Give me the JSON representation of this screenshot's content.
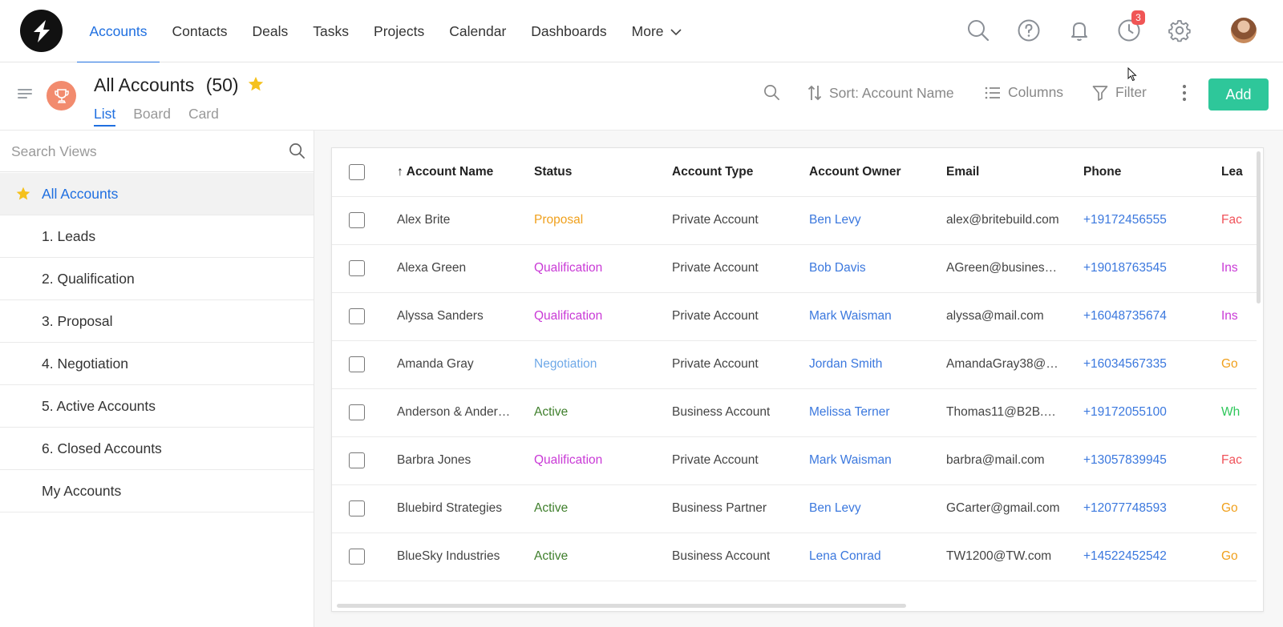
{
  "nav": {
    "links": [
      "Accounts",
      "Contacts",
      "Deals",
      "Tasks",
      "Projects",
      "Calendar",
      "Dashboards",
      "More"
    ],
    "active": "Accounts",
    "reminders_badge": "3"
  },
  "subheader": {
    "title": "All Accounts",
    "count": "(50)",
    "tabs": [
      "List",
      "Board",
      "Card"
    ],
    "active_tab": "List",
    "sort_label": "Sort: Account Name",
    "columns_label": "Columns",
    "filter_label": "Filter",
    "add_label": "Add"
  },
  "sidebar": {
    "search_placeholder": "Search Views",
    "views": [
      "All Accounts",
      "1. Leads",
      "2. Qualification",
      "3. Proposal",
      "4. Negotiation",
      "5. Active Accounts",
      "6. Closed Accounts",
      "My Accounts"
    ],
    "active_view": "All Accounts"
  },
  "table": {
    "columns": [
      "Account Name",
      "Status",
      "Account Type",
      "Account Owner",
      "Email",
      "Phone",
      "Lea"
    ],
    "sort_arrow": "↑",
    "rows": [
      {
        "name": "Alex Brite",
        "status": "Proposal",
        "type": "Private Account",
        "owner": "Ben Levy",
        "email": "alex@britebuild.com",
        "phone": "+19172456555",
        "lead": "Fac"
      },
      {
        "name": "Alexa Green",
        "status": "Qualification",
        "type": "Private Account",
        "owner": "Bob Davis",
        "email": "AGreen@busines…",
        "phone": "+19018763545",
        "lead": "Ins"
      },
      {
        "name": "Alyssa Sanders",
        "status": "Qualification",
        "type": "Private Account",
        "owner": "Mark Waisman",
        "email": "alyssa@mail.com",
        "phone": "+16048735674",
        "lead": "Ins"
      },
      {
        "name": "Amanda Gray",
        "status": "Negotiation",
        "type": "Private Account",
        "owner": "Jordan Smith",
        "email": "AmandaGray38@…",
        "phone": "+16034567335",
        "lead": "Go"
      },
      {
        "name": "Anderson & Ander…",
        "status": "Active",
        "type": "Business Account",
        "owner": "Melissa Terner",
        "email": "Thomas11@B2B.…",
        "phone": "+19172055100",
        "lead": "Wh"
      },
      {
        "name": "Barbra Jones",
        "status": "Qualification",
        "type": "Private Account",
        "owner": "Mark Waisman",
        "email": "barbra@mail.com",
        "phone": "+13057839945",
        "lead": "Fac"
      },
      {
        "name": "Bluebird Strategies",
        "status": "Active",
        "type": "Business Partner",
        "owner": "Ben Levy",
        "email": "GCarter@gmail.com",
        "phone": "+12077748593",
        "lead": "Go"
      },
      {
        "name": "BlueSky Industries",
        "status": "Active",
        "type": "Business Account",
        "owner": "Lena Conrad",
        "email": "TW1200@TW.com",
        "phone": "+14522452542",
        "lead": "Go"
      }
    ]
  },
  "colors": {
    "accent": "#1f6fe0",
    "add_button": "#2ec79a",
    "status": {
      "Proposal": "#f0a01c",
      "Qualification": "#c93ad6",
      "Negotiation": "#6fa9e8",
      "Active": "#3f7f2c"
    },
    "lead": {
      "Fac": "#f0525a",
      "Ins": "#c93ad6",
      "Go": "#f0a01c",
      "Wh": "#2ec75a"
    },
    "link": "#3b78de"
  }
}
